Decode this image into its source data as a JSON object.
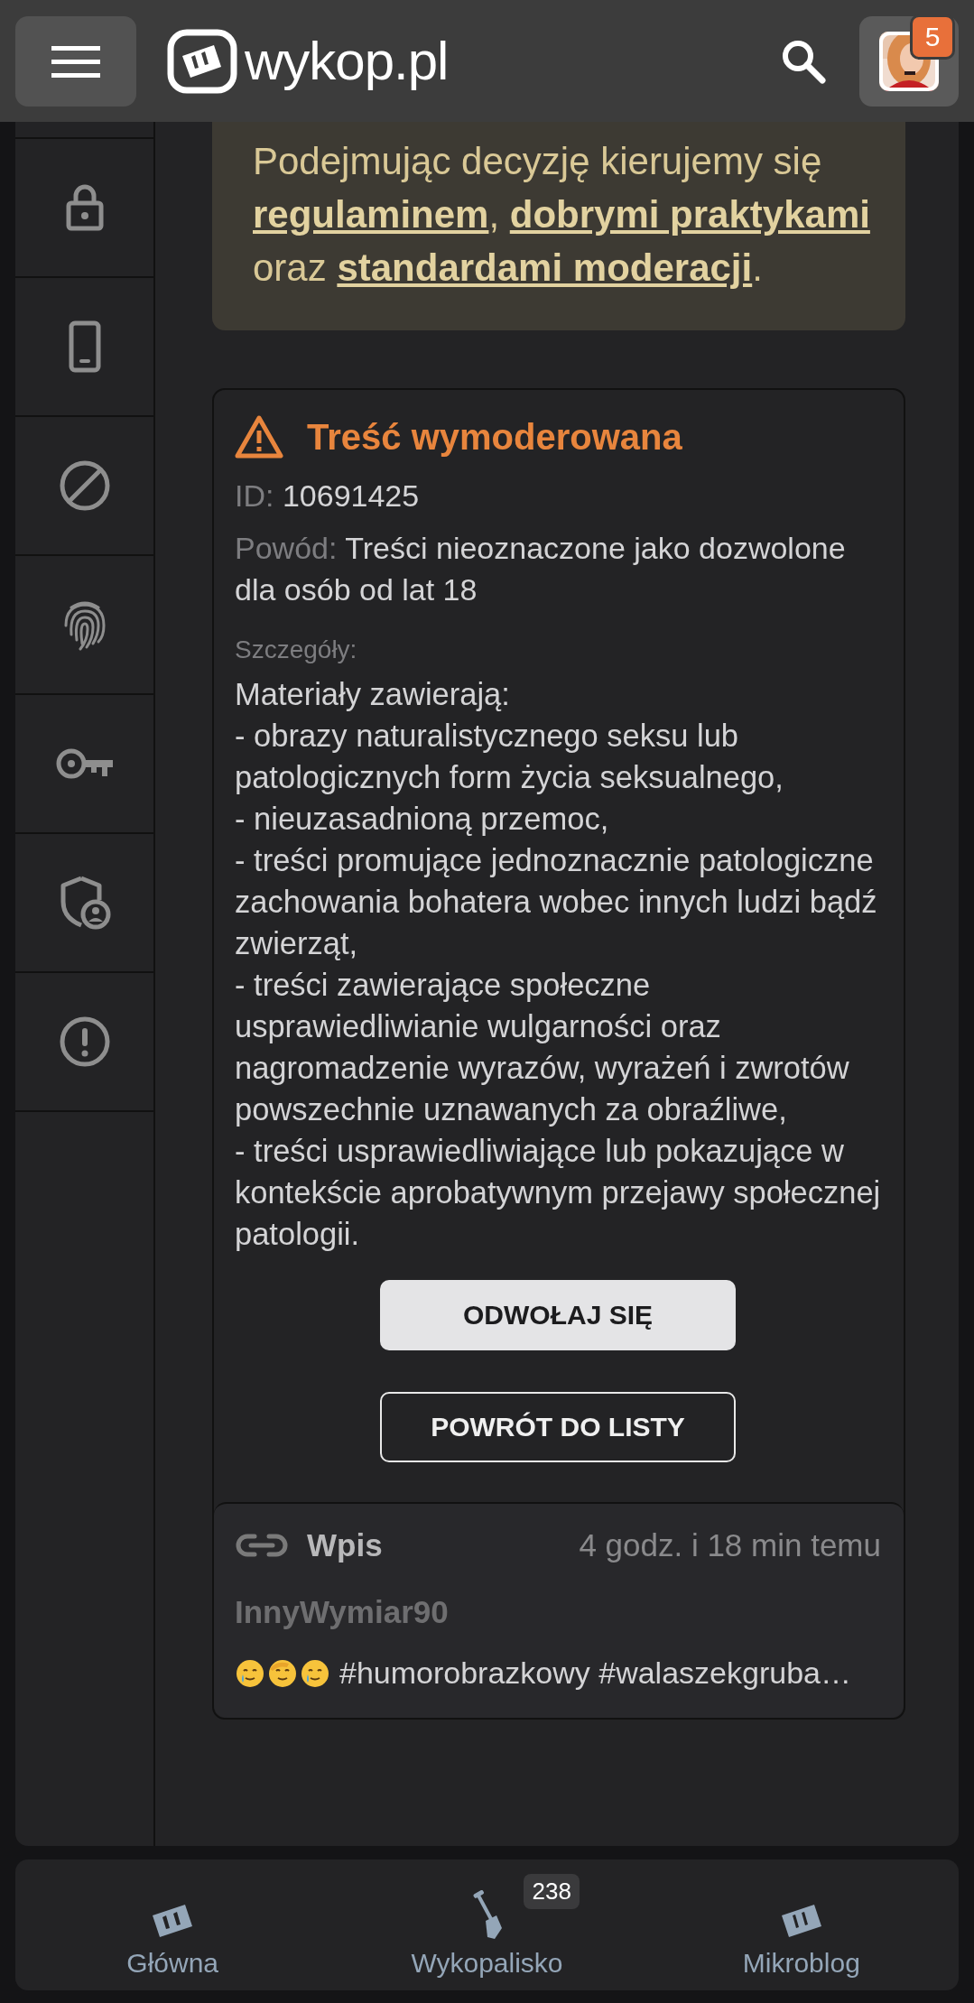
{
  "header": {
    "logo_text": "wykop.pl",
    "notification_count": "5"
  },
  "note": [
    {
      "kind": "text",
      "text": "Podejmując decyzję kierujemy się "
    },
    {
      "kind": "link",
      "text": "regulaminem"
    },
    {
      "kind": "text",
      "text": ", "
    },
    {
      "kind": "link",
      "text": "dobrymi praktykami"
    },
    {
      "kind": "text",
      "text": " oraz "
    },
    {
      "kind": "link",
      "text": "standardami moderacji"
    },
    {
      "kind": "text",
      "text": "."
    }
  ],
  "moderation": {
    "title": "Treść wymoderowana",
    "id_label": "ID:",
    "id_value": "10691425",
    "reason_label": "Powód:",
    "reason_value": "Treści nieoznaczone jako dozwolone dla osób od lat 18",
    "details_label": "Szczegóły:",
    "details": [
      "Materiały zawierają:",
      "- obrazy naturalistycznego seksu lub patologicznych form życia seksualnego,",
      "- nieuzasadnioną przemoc,",
      "- treści promujące jednoznacznie patologiczne zachowania bohatera wobec innych ludzi bądź zwierząt,",
      "- treści zawierające społeczne usprawiedliwianie wulgarności oraz nagromadzenie wyrazów, wyrażeń i zwrotów powszechnie uznawanych za obraźliwe,",
      "- treści usprawiedliwiające lub pokazujące w kontekście aprobatywnym przejawy społecznej patologii."
    ],
    "buttons": [
      {
        "label": "ODWOŁAJ SIĘ",
        "kind": "filled"
      },
      {
        "label": "POWRÓT DO LISTY",
        "kind": "outline"
      }
    ],
    "entry": {
      "type": "Wpis",
      "time": "4 godz. i 18 min temu",
      "author": "InnyWymiar90",
      "content": "#humorobrazkowy #walaszekgruba…"
    }
  },
  "bottom_nav": [
    {
      "label": "Główna"
    },
    {
      "label": "Wykopalisko",
      "count": "238"
    },
    {
      "label": "Mikroblog"
    }
  ]
}
